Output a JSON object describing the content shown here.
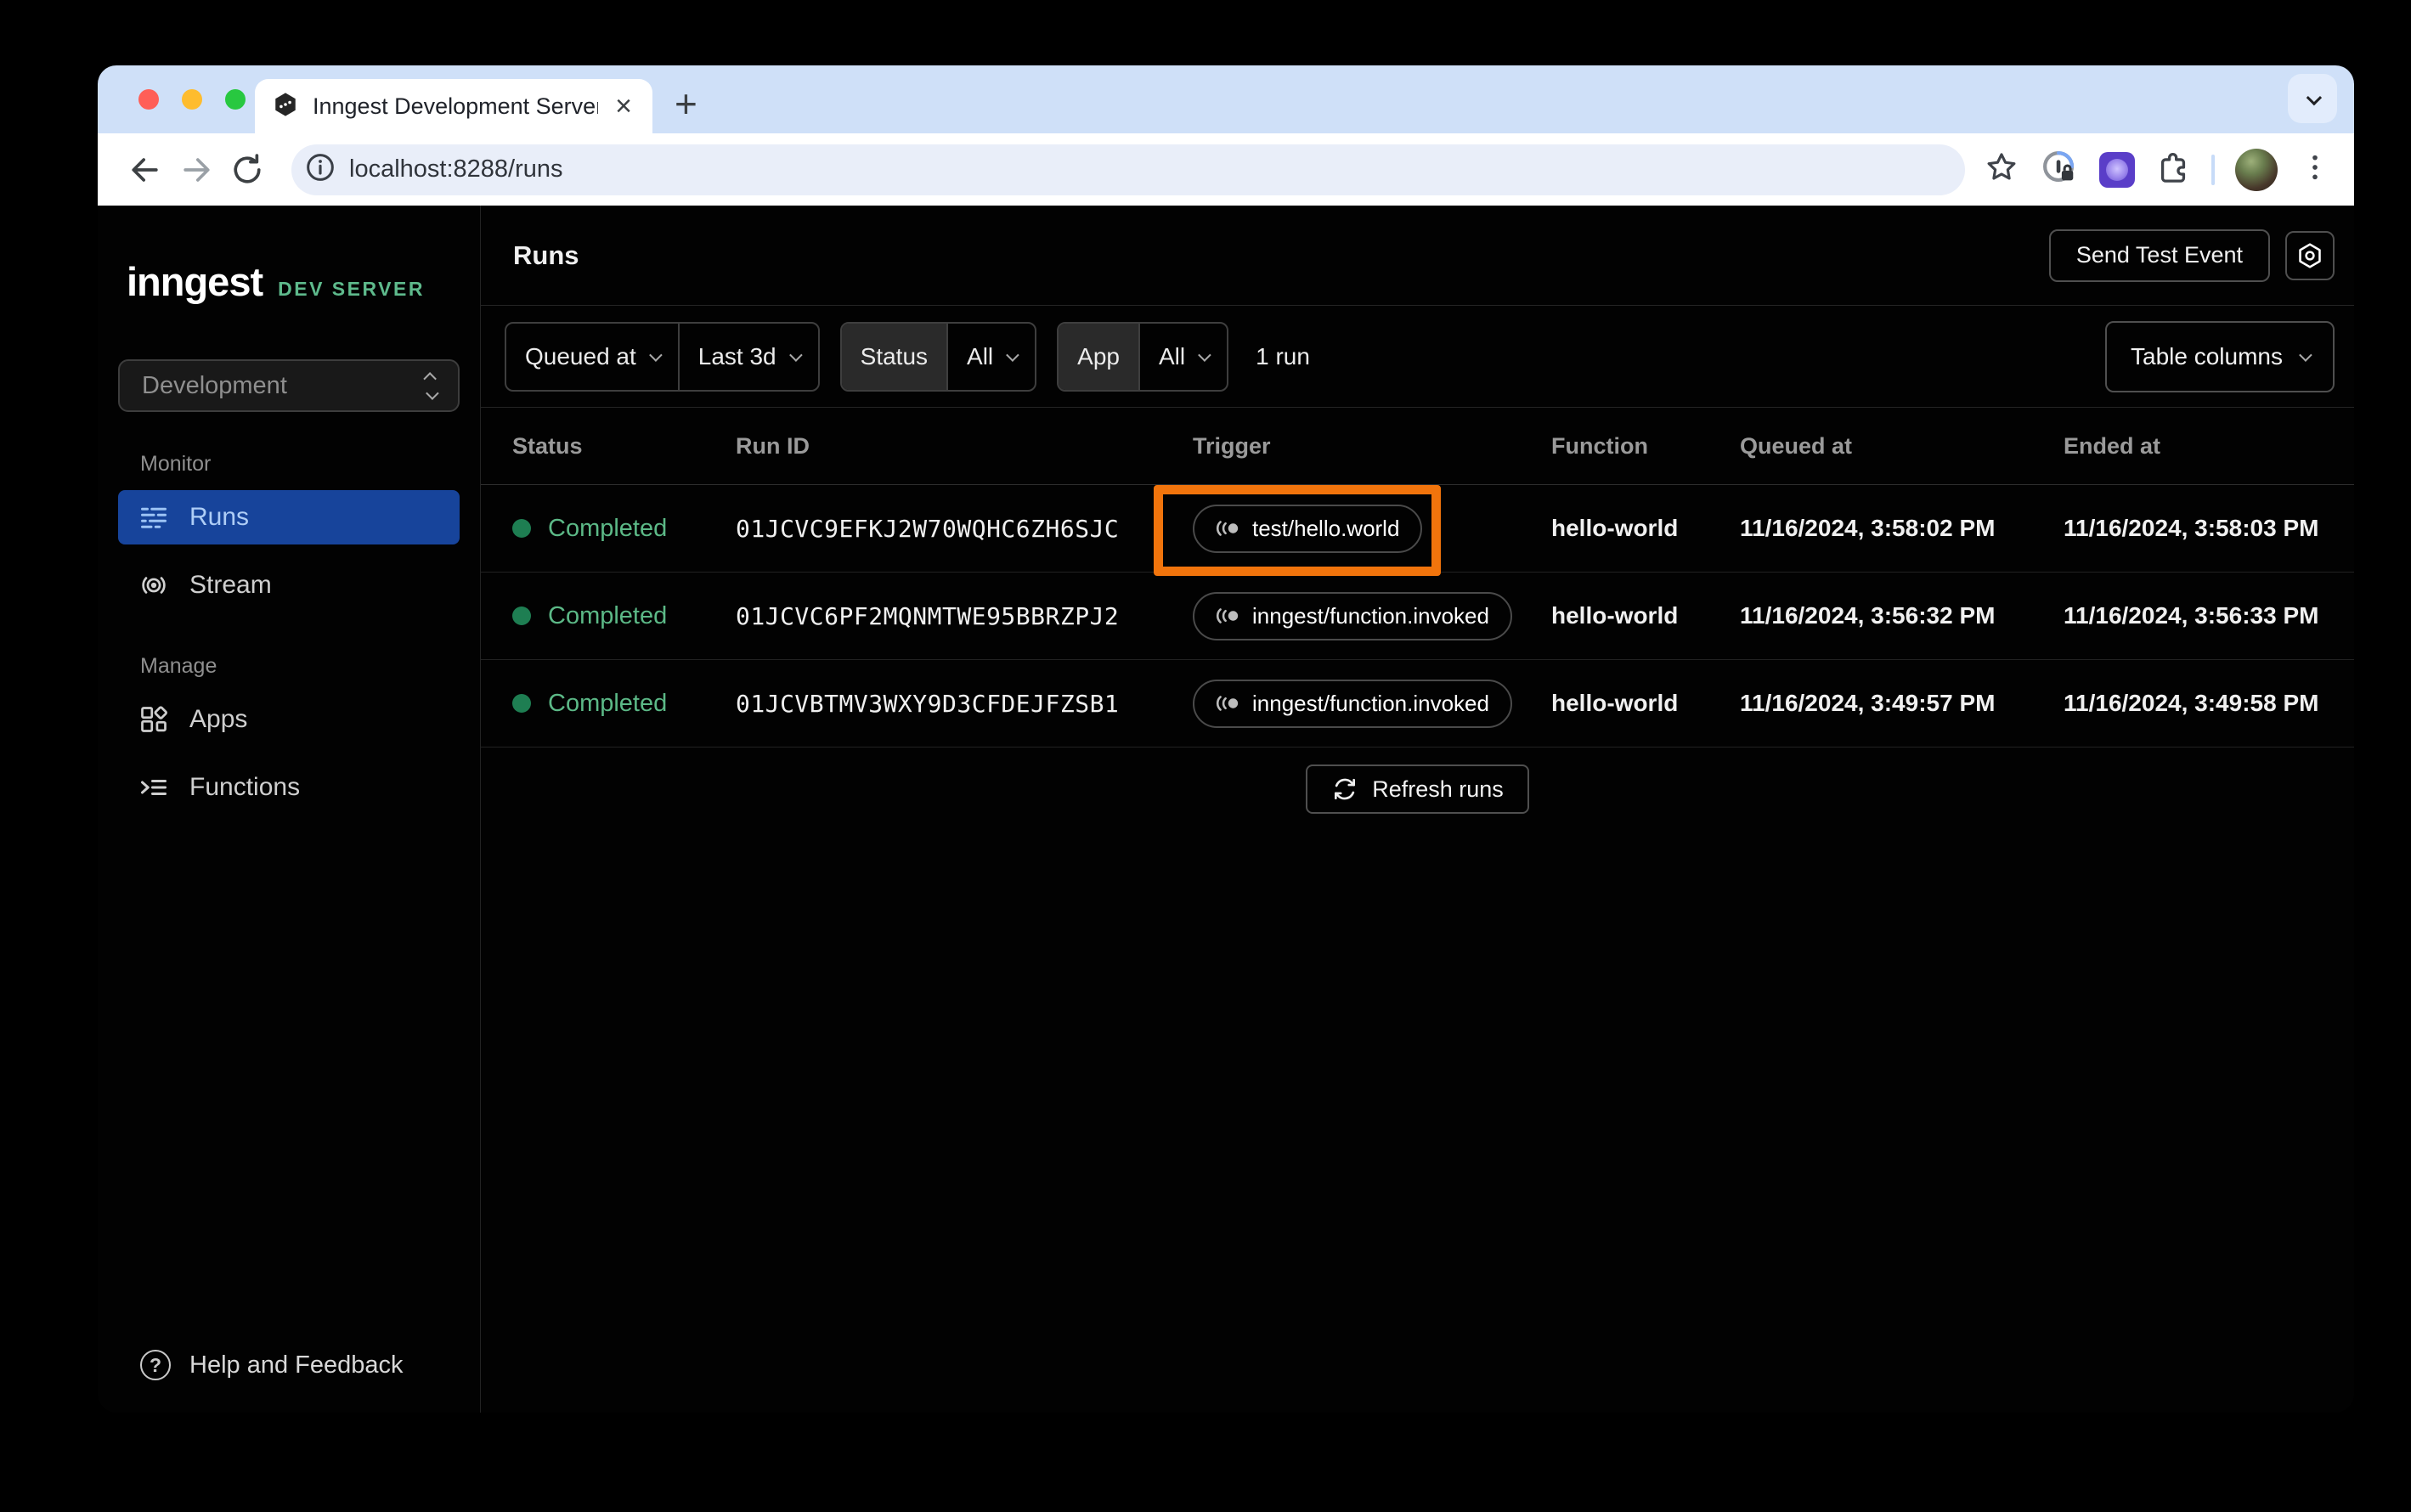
{
  "browser": {
    "tab_title": "Inngest Development Server",
    "url": "localhost:8288/runs"
  },
  "icons": {
    "close_glyph": "×",
    "new_tab_glyph": "+",
    "help_glyph": "?"
  },
  "sidebar": {
    "logo": "inngest",
    "badge": "DEV SERVER",
    "environment": "Development",
    "monitor_label": "Monitor",
    "manage_label": "Manage",
    "items": {
      "runs": "Runs",
      "stream": "Stream",
      "apps": "Apps",
      "functions": "Functions"
    },
    "help": "Help and Feedback"
  },
  "header": {
    "title": "Runs",
    "send_test_event": "Send Test Event"
  },
  "filters": {
    "queued_at": "Queued at",
    "time_range": "Last 3d",
    "status_label": "Status",
    "status_value": "All",
    "app_label": "App",
    "app_value": "All",
    "run_count": "1 run",
    "table_columns": "Table columns"
  },
  "table": {
    "columns": [
      "Status",
      "Run ID",
      "Trigger",
      "Function",
      "Queued at",
      "Ended at"
    ],
    "rows": [
      {
        "status": "Completed",
        "run_id": "01JCVC9EFKJ2W70WQHC6ZH6SJC",
        "trigger": "test/hello.world",
        "function": "hello-world",
        "queued_at": "11/16/2024, 3:58:02 PM",
        "ended_at": "11/16/2024, 3:58:03 PM",
        "highlighted": true
      },
      {
        "status": "Completed",
        "run_id": "01JCVC6PF2MQNMTWE95BBRZPJ2",
        "trigger": "inngest/function.invoked",
        "function": "hello-world",
        "queued_at": "11/16/2024, 3:56:32 PM",
        "ended_at": "11/16/2024, 3:56:33 PM",
        "highlighted": false
      },
      {
        "status": "Completed",
        "run_id": "01JCVBTMV3WXY9D3CFDEJFZSB1",
        "trigger": "inngest/function.invoked",
        "function": "hello-world",
        "queued_at": "11/16/2024, 3:49:57 PM",
        "ended_at": "11/16/2024, 3:49:58 PM",
        "highlighted": false
      }
    ]
  },
  "refresh_button": "Refresh runs",
  "colors": {
    "highlight_orange": "#F1740C",
    "status_green_text": "#5CB987",
    "status_green_dot": "#1E7E52",
    "active_nav_blue": "#17449B",
    "dev_server_green": "#5EBA8C"
  }
}
